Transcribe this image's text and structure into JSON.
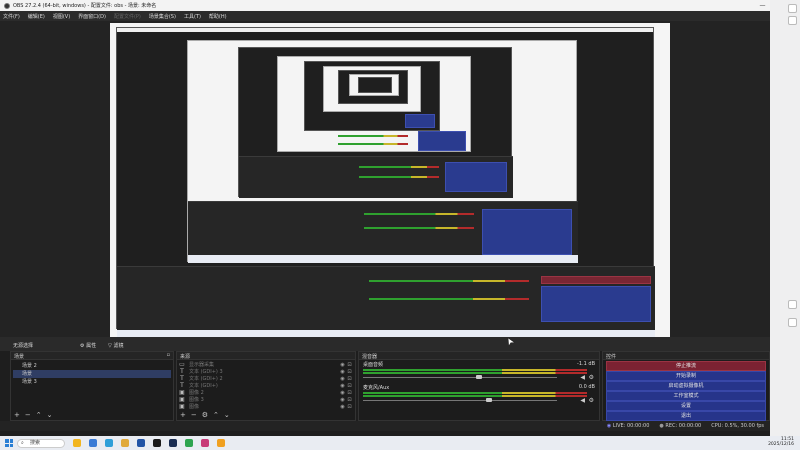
{
  "window": {
    "title": "OBS 27.2.4 (64-bit, windows) - 配置文件: obs - 场景: 未命名",
    "controls": [
      "—",
      "☐",
      "✕"
    ]
  },
  "menu": [
    {
      "label": "文件(F)",
      "disabled": false
    },
    {
      "label": "编辑(E)",
      "disabled": false
    },
    {
      "label": "视图(V)",
      "disabled": false
    },
    {
      "label": "界面窗口(D)",
      "disabled": false
    },
    {
      "label": "配置文件(P)",
      "disabled": true
    },
    {
      "label": "场景集合(S)",
      "disabled": false
    },
    {
      "label": "工具(T)",
      "disabled": false
    },
    {
      "label": "帮助(H)",
      "disabled": false
    }
  ],
  "dock": {
    "scene_collection_label": "无源选择",
    "properties_label": "属性",
    "filters_label": "滤镜"
  },
  "scenes": {
    "header": "场景",
    "items": [
      {
        "label": "场景 2",
        "active": false
      },
      {
        "label": "场景",
        "active": true
      },
      {
        "label": "场景 3",
        "active": false
      }
    ]
  },
  "sources": {
    "header": "来源",
    "items": [
      {
        "icon": "display-capture-icon",
        "glyph": "▭",
        "label": "显示器采集"
      },
      {
        "icon": "text-icon",
        "glyph": "T",
        "label": "文本 (GDI+) 3"
      },
      {
        "icon": "text-icon",
        "glyph": "T",
        "label": "文本 (GDI+) 2"
      },
      {
        "icon": "text-icon",
        "glyph": "T",
        "label": "文本 (GDI+)"
      },
      {
        "icon": "image-icon",
        "glyph": "▣",
        "label": "图像 2"
      },
      {
        "icon": "image-icon",
        "glyph": "▣",
        "label": "图像 3"
      },
      {
        "icon": "image-icon",
        "glyph": "▣",
        "label": "图像"
      }
    ]
  },
  "mixer": {
    "header": "混音器",
    "channels": [
      {
        "name": "桌面音频",
        "db": "-1.1 dB",
        "level": 0.6
      },
      {
        "name": "麦克风/Aux",
        "db": "0.0 dB",
        "level": 0.65
      }
    ]
  },
  "controls": {
    "header": "控件",
    "buttons": [
      {
        "label": "停止推流",
        "stop": true
      },
      {
        "label": "开始录制",
        "stop": false
      },
      {
        "label": "启动虚拟摄像机",
        "stop": false
      },
      {
        "label": "工作室模式",
        "stop": false
      },
      {
        "label": "设置",
        "stop": false
      },
      {
        "label": "退出",
        "stop": false
      }
    ]
  },
  "status": {
    "live": "LIVE: 00:00:00",
    "rec": "REC: 00:00:00",
    "cpu": "CPU: 0.5%, 30.00 fps"
  },
  "taskbar": {
    "search_placeholder": "搜索",
    "time": "11:51",
    "date": "2025/12/16"
  },
  "colors": {
    "accent_blue": "#26348a",
    "stop_red": "#7b2232",
    "meter_green": "#2fa12f",
    "meter_yellow": "#c7b62a",
    "meter_red": "#b32b2b"
  }
}
